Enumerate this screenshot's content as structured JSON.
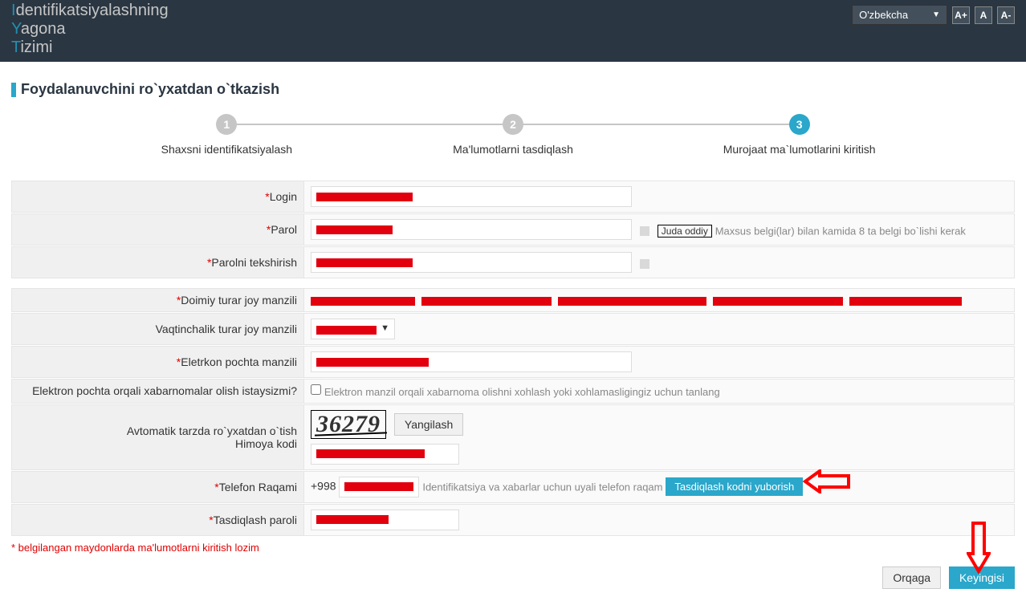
{
  "header": {
    "logo_line1": "Identifikatsiyalashning",
    "logo_line2": "Yagona",
    "logo_line3": "Tizimi",
    "language": "O'zbekcha",
    "font_up": "A+",
    "font_mid": "A",
    "font_down": "A-"
  },
  "page_title": "Foydalanuvchini ro`yxatdan o`tkazish",
  "steps": {
    "s1": "Shaxsni identifikatsiyalash",
    "s2": "Ma'lumotlarni tasdiqlash",
    "s3": "Murojaat ma`lumotlarini kiritish"
  },
  "labels": {
    "login": "Login",
    "password": "Parol",
    "password_confirm": "Parolni tekshirish",
    "perm_address": "Doimiy turar joy manzili",
    "temp_address": "Vaqtinchalik turar joy manzili",
    "email": "Eletrkon pochta manzili",
    "email_opt": "Elektron pochta orqali xabarnomalar olish istaysizmi?",
    "captcha_l1": "Avtomatik tarzda ro`yxatdan o`tish",
    "captcha_l2": "Himoya kodi",
    "phone": "Telefon Raqami",
    "confirm_code": "Tasdiqlash paroli"
  },
  "fields": {
    "pw_strength": "Juda oddiy",
    "pw_hint": "Maxsus belgi(lar) bilan kamida 8 ta belgi bo`lishi kerak",
    "email_opt_hint": "Elektron manzil orqali xabarnoma olishni xohlash yoki xohlamasligingiz uchun tanlang",
    "captcha_value": "36279",
    "refresh": "Yangilash",
    "phone_prefix": "+998",
    "phone_hint": "Identifikatsiya va xabarlar uchun uyali telefon raqam",
    "send_code": "Tasdiqlash kodni yuborish"
  },
  "footnote": "* belgilangan maydonlarda ma'lumotlarni kiritish lozim",
  "nav": {
    "back": "Orqaga",
    "next": "Keyingisi"
  }
}
